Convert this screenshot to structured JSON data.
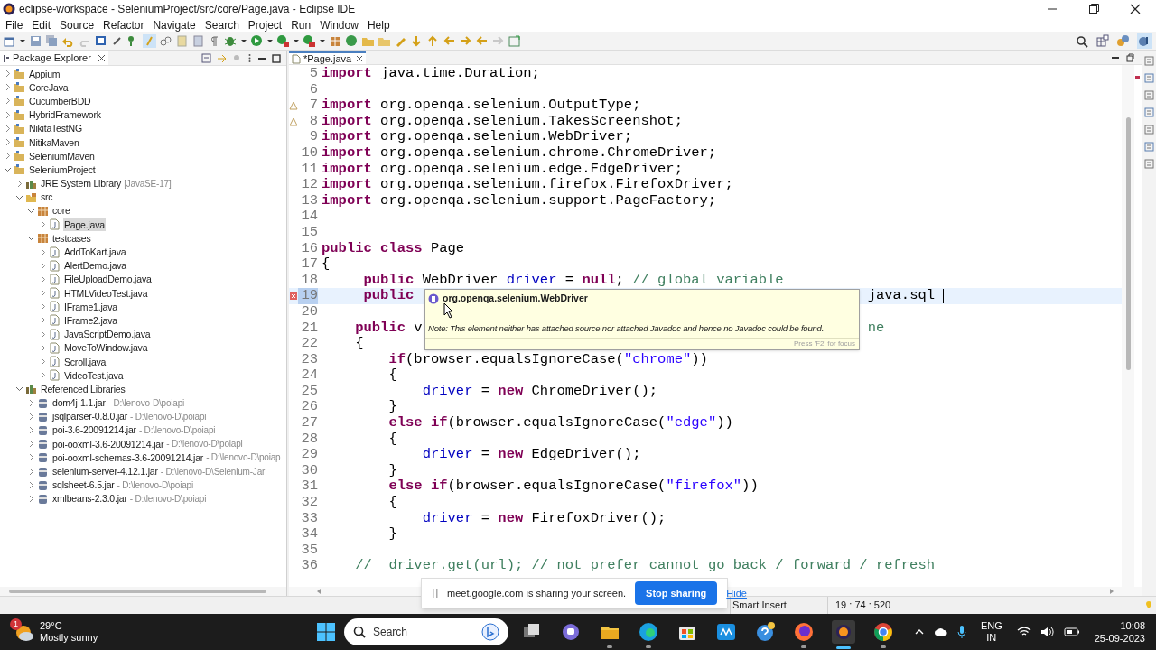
{
  "window": {
    "title": "eclipse-workspace - SeleniumProject/src/core/Page.java - Eclipse IDE"
  },
  "menu": [
    "File",
    "Edit",
    "Source",
    "Refactor",
    "Navigate",
    "Search",
    "Project",
    "Run",
    "Window",
    "Help"
  ],
  "package_explorer": {
    "title": "Package Explorer",
    "tree": [
      {
        "label": "Appium",
        "kind": "project",
        "expanded": false,
        "selected": false
      },
      {
        "label": "CoreJava",
        "kind": "project",
        "expanded": false,
        "selected": false
      },
      {
        "label": "CucumberBDD",
        "kind": "project",
        "expanded": false,
        "selected": false
      },
      {
        "label": "HybridFramework",
        "kind": "project",
        "expanded": false,
        "selected": false
      },
      {
        "label": "NikitaTestNG",
        "kind": "project",
        "expanded": false,
        "selected": false
      },
      {
        "label": "NitikaMaven",
        "kind": "project",
        "expanded": false,
        "selected": false
      },
      {
        "label": "SeleniumMaven",
        "kind": "project",
        "expanded": false,
        "selected": false
      },
      {
        "label": "SeleniumProject",
        "kind": "project",
        "expanded": true,
        "selected": false,
        "children": [
          {
            "label": "JRE System Library",
            "decoration": "[JavaSE-17]",
            "kind": "library",
            "expanded": false,
            "selected": false
          },
          {
            "label": "src",
            "kind": "source_folder",
            "expanded": true,
            "selected": false,
            "children": [
              {
                "label": "core",
                "kind": "package",
                "expanded": true,
                "selected": false,
                "children": [
                  {
                    "label": "Page.java",
                    "kind": "java",
                    "expanded": false,
                    "selected": true
                  }
                ]
              },
              {
                "label": "testcases",
                "kind": "package",
                "expanded": true,
                "selected": false,
                "children": [
                  {
                    "label": "AddToKart.java",
                    "kind": "java",
                    "expanded": false,
                    "selected": false
                  },
                  {
                    "label": "AlertDemo.java",
                    "kind": "java",
                    "expanded": false,
                    "selected": false
                  },
                  {
                    "label": "FileUploadDemo.java",
                    "kind": "java",
                    "expanded": false,
                    "selected": false
                  },
                  {
                    "label": "HTMLVideoTest.java",
                    "kind": "java",
                    "expanded": false,
                    "selected": false
                  },
                  {
                    "label": "IFrame1.java",
                    "kind": "java",
                    "expanded": false,
                    "selected": false
                  },
                  {
                    "label": "IFrame2.java",
                    "kind": "java",
                    "expanded": false,
                    "selected": false
                  },
                  {
                    "label": "JavaScriptDemo.java",
                    "kind": "java",
                    "expanded": false,
                    "selected": false
                  },
                  {
                    "label": "MoveToWindow.java",
                    "kind": "java",
                    "expanded": false,
                    "selected": false
                  },
                  {
                    "label": "Scroll.java",
                    "kind": "java",
                    "expanded": false,
                    "selected": false
                  },
                  {
                    "label": "VideoTest.java",
                    "kind": "java",
                    "expanded": false,
                    "selected": false
                  }
                ]
              }
            ]
          },
          {
            "label": "Referenced Libraries",
            "kind": "library",
            "expanded": true,
            "selected": false,
            "children": [
              {
                "label": "dom4j-1.1.jar",
                "decoration": "- D:\\lenovo-D\\poiapi",
                "kind": "jar",
                "expanded": false,
                "selected": false
              },
              {
                "label": "jsqlparser-0.8.0.jar",
                "decoration": "- D:\\lenovo-D\\poiapi",
                "kind": "jar",
                "expanded": false,
                "selected": false
              },
              {
                "label": "poi-3.6-20091214.jar",
                "decoration": "- D:\\lenovo-D\\poiapi",
                "kind": "jar",
                "expanded": false,
                "selected": false
              },
              {
                "label": "poi-ooxml-3.6-20091214.jar",
                "decoration": "- D:\\lenovo-D\\poiapi",
                "kind": "jar",
                "expanded": false,
                "selected": false
              },
              {
                "label": "poi-ooxml-schemas-3.6-20091214.jar",
                "decoration": "- D:\\lenovo-D\\poiap",
                "kind": "jar",
                "expanded": false,
                "selected": false
              },
              {
                "label": "selenium-server-4.12.1.jar",
                "decoration": "- D:\\lenovo-D\\Selenium-Jar",
                "kind": "jar",
                "expanded": false,
                "selected": false
              },
              {
                "label": "sqlsheet-6.5.jar",
                "decoration": "- D:\\lenovo-D\\poiapi",
                "kind": "jar",
                "expanded": false,
                "selected": false
              },
              {
                "label": "xmlbeans-2.3.0.jar",
                "decoration": "- D:\\lenovo-D\\poiapi",
                "kind": "jar",
                "expanded": false,
                "selected": false
              }
            ]
          }
        ]
      }
    ]
  },
  "editor": {
    "tab": "*Page.java",
    "lines": [
      {
        "number": "5",
        "current": false,
        "warning": false,
        "error": false,
        "parts": [
          {
            "kind": "keyword",
            "text": "import"
          },
          {
            "kind": "plain",
            "text": " java.time.Duration;"
          }
        ]
      },
      {
        "number": "6",
        "current": false,
        "warning": false,
        "error": false
      },
      {
        "number": "7",
        "current": false,
        "warning": true,
        "error": false,
        "parts": [
          {
            "kind": "keyword",
            "text": "import"
          },
          {
            "kind": "plain",
            "text": " org.openqa.selenium.OutputType;"
          }
        ]
      },
      {
        "number": "8",
        "current": false,
        "warning": true,
        "error": false,
        "parts": [
          {
            "kind": "keyword",
            "text": "import"
          },
          {
            "kind": "plain",
            "text": " org.openqa.selenium.TakesScreenshot;"
          }
        ]
      },
      {
        "number": "9",
        "current": false,
        "warning": false,
        "error": false,
        "parts": [
          {
            "kind": "keyword",
            "text": "import"
          },
          {
            "kind": "plain",
            "text": " org.openqa.selenium.WebDriver;"
          }
        ]
      },
      {
        "number": "10",
        "current": false,
        "warning": false,
        "error": false,
        "parts": [
          {
            "kind": "keyword",
            "text": "import"
          },
          {
            "kind": "plain",
            "text": " org.openqa.selenium.chrome.ChromeDriver;"
          }
        ]
      },
      {
        "number": "11",
        "current": false,
        "warning": false,
        "error": false,
        "parts": [
          {
            "kind": "keyword",
            "text": "import"
          },
          {
            "kind": "plain",
            "text": " org.openqa.selenium.edge.EdgeDriver;"
          }
        ]
      },
      {
        "number": "12",
        "current": false,
        "warning": false,
        "error": false,
        "parts": [
          {
            "kind": "keyword",
            "text": "import"
          },
          {
            "kind": "plain",
            "text": " org.openqa.selenium.firefox.FirefoxDriver;"
          }
        ]
      },
      {
        "number": "13",
        "current": false,
        "warning": false,
        "error": false,
        "parts": [
          {
            "kind": "keyword",
            "text": "import"
          },
          {
            "kind": "plain",
            "text": " org.openqa.selenium.support.PageFactory;"
          }
        ]
      },
      {
        "number": "14",
        "current": false,
        "warning": false,
        "error": false
      },
      {
        "number": "15",
        "current": false,
        "warning": false,
        "error": false
      },
      {
        "number": "16",
        "current": false,
        "warning": false,
        "error": false,
        "parts": [
          {
            "kind": "keyword",
            "text": "public class"
          },
          {
            "kind": "plain",
            "text": " Page"
          }
        ]
      },
      {
        "number": "17",
        "current": false,
        "warning": false,
        "error": false,
        "parts": [
          {
            "kind": "plain",
            "text": "{"
          }
        ]
      },
      {
        "number": "18",
        "current": false,
        "warning": false,
        "error": false,
        "parts": [
          {
            "kind": "keyword",
            "text": "     public"
          },
          {
            "kind": "plain",
            "text": " WebDriver "
          },
          {
            "kind": "field",
            "text": "driver"
          },
          {
            "kind": "plain",
            "text": " = "
          },
          {
            "kind": "keyword",
            "text": "null"
          },
          {
            "kind": "plain",
            "text": "; "
          },
          {
            "kind": "comment",
            "text": "// global variable"
          }
        ]
      },
      {
        "number": "19",
        "current": true,
        "warning": false,
        "error": true,
        "parts": [
          {
            "kind": "keyword",
            "text": "     public"
          },
          {
            "kind": "plain",
            "text": "                                                      java.sql"
          }
        ]
      },
      {
        "number": "20",
        "current": false,
        "warning": false,
        "error": false
      },
      {
        "number": "21",
        "current": false,
        "warning": false,
        "error": false,
        "parts": [
          {
            "kind": "keyword",
            "text": "    public"
          },
          {
            "kind": "plain",
            "text": " v"
          },
          {
            "kind": "comment",
            "text": "                                                     ne"
          }
        ]
      },
      {
        "number": "22",
        "current": false,
        "warning": false,
        "error": false,
        "parts": [
          {
            "kind": "plain",
            "text": "    {"
          }
        ]
      },
      {
        "number": "23",
        "current": false,
        "warning": false,
        "error": false,
        "parts": [
          {
            "kind": "keyword",
            "text": "        if"
          },
          {
            "kind": "plain",
            "text": "(browser.equalsIgnoreCase("
          },
          {
            "kind": "string",
            "text": "\"chrome\""
          },
          {
            "kind": "plain",
            "text": "))"
          }
        ]
      },
      {
        "number": "24",
        "current": false,
        "warning": false,
        "error": false,
        "parts": [
          {
            "kind": "plain",
            "text": "        {"
          }
        ]
      },
      {
        "number": "25",
        "current": false,
        "warning": false,
        "error": false,
        "parts": [
          {
            "kind": "field",
            "text": "            driver"
          },
          {
            "kind": "plain",
            "text": " = "
          },
          {
            "kind": "keyword",
            "text": "new"
          },
          {
            "kind": "plain",
            "text": " ChromeDriver();"
          }
        ]
      },
      {
        "number": "26",
        "current": false,
        "warning": false,
        "error": false,
        "parts": [
          {
            "kind": "plain",
            "text": "        }"
          }
        ]
      },
      {
        "number": "27",
        "current": false,
        "warning": false,
        "error": false,
        "parts": [
          {
            "kind": "keyword",
            "text": "        else if"
          },
          {
            "kind": "plain",
            "text": "(browser.equalsIgnoreCase("
          },
          {
            "kind": "string",
            "text": "\"edge\""
          },
          {
            "kind": "plain",
            "text": "))"
          }
        ]
      },
      {
        "number": "28",
        "current": false,
        "warning": false,
        "error": false,
        "parts": [
          {
            "kind": "plain",
            "text": "        {"
          }
        ]
      },
      {
        "number": "29",
        "current": false,
        "warning": false,
        "error": false,
        "parts": [
          {
            "kind": "field",
            "text": "            driver"
          },
          {
            "kind": "plain",
            "text": " = "
          },
          {
            "kind": "keyword",
            "text": "new"
          },
          {
            "kind": "plain",
            "text": " EdgeDriver();"
          }
        ]
      },
      {
        "number": "30",
        "current": false,
        "warning": false,
        "error": false,
        "parts": [
          {
            "kind": "plain",
            "text": "        }"
          }
        ]
      },
      {
        "number": "31",
        "current": false,
        "warning": false,
        "error": false,
        "parts": [
          {
            "kind": "keyword",
            "text": "        else if"
          },
          {
            "kind": "plain",
            "text": "(browser.equalsIgnoreCase("
          },
          {
            "kind": "string",
            "text": "\"firefox\""
          },
          {
            "kind": "plain",
            "text": "))"
          }
        ]
      },
      {
        "number": "32",
        "current": false,
        "warning": false,
        "error": false,
        "parts": [
          {
            "kind": "plain",
            "text": "        {"
          }
        ]
      },
      {
        "number": "33",
        "current": false,
        "warning": false,
        "error": false,
        "parts": [
          {
            "kind": "field",
            "text": "            driver"
          },
          {
            "kind": "plain",
            "text": " = "
          },
          {
            "kind": "keyword",
            "text": "new"
          },
          {
            "kind": "plain",
            "text": " FirefoxDriver();"
          }
        ]
      },
      {
        "number": "34",
        "current": false,
        "warning": false,
        "error": false,
        "parts": [
          {
            "kind": "plain",
            "text": "        }"
          }
        ]
      },
      {
        "number": "35",
        "current": false,
        "warning": false,
        "error": false
      },
      {
        "number": "36",
        "current": false,
        "warning": false,
        "error": false,
        "parts": [
          {
            "kind": "comment",
            "text": "    //  driver.get(url); // not prefer cannot go back / forward / refresh"
          }
        ]
      }
    ]
  },
  "tooltip": {
    "title": "org.openqa.selenium.WebDriver",
    "note": "Note: This element neither has attached source nor attached Javadoc and hence no Javadoc could be found.",
    "footer": "Press 'F2' for focus"
  },
  "status_bar": [
    "Smart Insert",
    "19 : 74 : 520"
  ],
  "sharing_bar": {
    "message": "meet.google.com is sharing your screen.",
    "stop_button": "Stop sharing",
    "hide_link": "Hide"
  },
  "taskbar": {
    "weather": {
      "badge": "1",
      "temperature": "29°C",
      "condition": "Mostly sunny"
    },
    "search": {
      "placeholder": "Search"
    },
    "language": "ENG",
    "region": "IN",
    "time": "10:08",
    "date": "25-09-2023"
  }
}
